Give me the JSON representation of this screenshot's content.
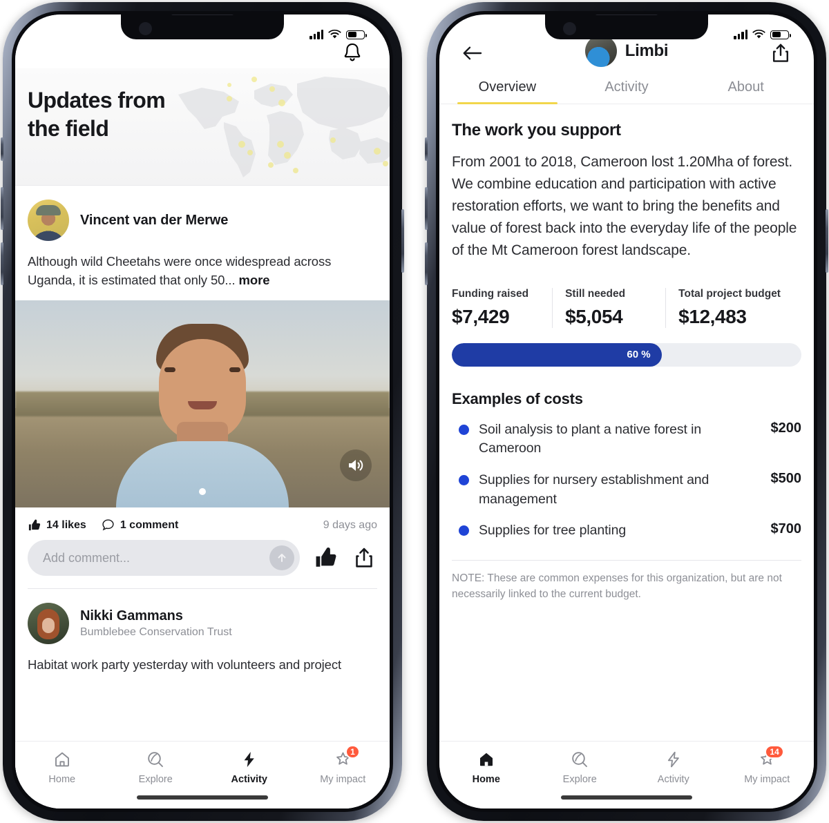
{
  "left_phone": {
    "status_bar": {
      "signal": "cellular-bars",
      "wifi": "wifi-icon",
      "battery_pct": 55
    },
    "header": {
      "bell": "bell-icon"
    },
    "hero": {
      "title_line1": "Updates from",
      "title_line2": "the field"
    },
    "posts": [
      {
        "author": "Vincent van der Merwe",
        "org": "",
        "text": "Although wild Cheetahs were once widespread across Uganda, it is estimated that only 50...",
        "more_label": "more",
        "media_sound_icon": "speaker-on-icon",
        "likes": "14 likes",
        "comments": "1 comment",
        "timestamp": "9 days ago",
        "comment_placeholder": "Add comment...",
        "comment_value": ""
      },
      {
        "author": "Nikki Gammans",
        "org": "Bumblebee Conservation Trust",
        "text": "Habitat work party yesterday with volunteers and project"
      }
    ],
    "tabbar": [
      {
        "label": "Home",
        "icon": "home-icon",
        "active": false,
        "badge": ""
      },
      {
        "label": "Explore",
        "icon": "explore-icon",
        "active": false,
        "badge": ""
      },
      {
        "label": "Activity",
        "icon": "activity-bolt-icon",
        "active": true,
        "badge": ""
      },
      {
        "label": "My impact",
        "icon": "star-bookmark-icon",
        "active": false,
        "badge": "1"
      }
    ]
  },
  "right_phone": {
    "status_bar": {
      "signal": "cellular-bars",
      "wifi": "wifi-icon",
      "battery_pct": 55
    },
    "header": {
      "back": "back-arrow-icon",
      "org_name": "Limbi",
      "share": "share-icon"
    },
    "tabs": [
      {
        "label": "Overview",
        "active": true
      },
      {
        "label": "Activity",
        "active": false
      },
      {
        "label": "About",
        "active": false
      }
    ],
    "section": {
      "title": "The work you support",
      "paragraph": "From 2001 to 2018, Cameroon lost 1.20Mha of forest. We combine education and participation with active restoration efforts, we want to bring the benefits and value of forest back into the everyday life of the people of the Mt Cameroon forest landscape."
    },
    "stats": [
      {
        "label": "Funding raised",
        "value": "$7,429"
      },
      {
        "label": "Still needed",
        "value": "$5,054"
      },
      {
        "label": "Total project budget",
        "value": "$12,483"
      }
    ],
    "progress": {
      "label": "60 %",
      "percent": 60,
      "color": "#1f3ca5",
      "track": "#eceef2"
    },
    "costs": {
      "title": "Examples of costs",
      "items": [
        {
          "label": "Soil analysis to plant a native forest in Cameroon",
          "amount": "$200"
        },
        {
          "label": "Supplies for nursery establishment and management",
          "amount": "$500"
        },
        {
          "label": "Supplies for tree planting",
          "amount": "$700"
        }
      ]
    },
    "note": "NOTE: These are common expenses for this organization, but are not necessarily linked to the current budget.",
    "tabbar": [
      {
        "label": "Home",
        "icon": "home-icon",
        "active": true,
        "badge": ""
      },
      {
        "label": "Explore",
        "icon": "explore-icon",
        "active": false,
        "badge": ""
      },
      {
        "label": "Activity",
        "icon": "activity-bolt-icon",
        "active": false,
        "badge": ""
      },
      {
        "label": "My impact",
        "icon": "star-bookmark-icon",
        "active": false,
        "badge": "14"
      }
    ]
  },
  "colors": {
    "accent_yellow": "#f2d64b",
    "blue": "#1f3ca5",
    "bullet_blue": "#1f44d6",
    "badge_red": "#ff5a3c"
  }
}
